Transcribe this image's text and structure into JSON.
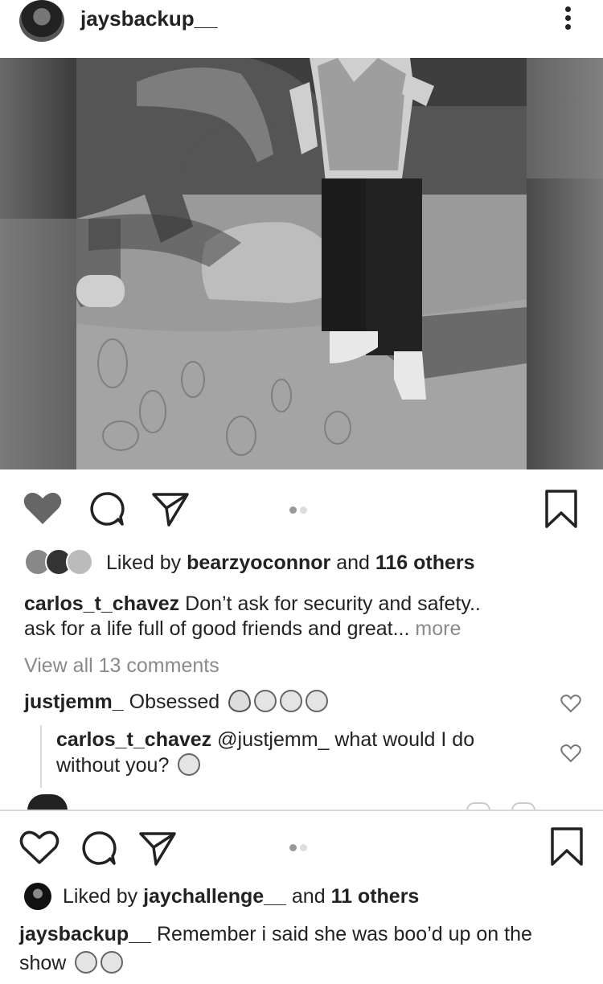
{
  "post1": {
    "username": "jaysbackup__",
    "liked_by_prefix": "Liked by ",
    "liked_by_user": "bearzyoconnor",
    "liked_by_and": " and ",
    "liked_by_others": "116 others",
    "caption_user": "carlos_t_chavez",
    "caption_line1": " Don’t ask for security and safety..",
    "caption_line2": "ask for a life full of good friends and great...",
    "caption_more": " more",
    "view_comments": "View all 13 comments",
    "comment1_user": "justjemm_",
    "comment1_text": " Obsessed ",
    "reply_user": "carlos_t_chavez",
    "reply_text_line1": " @justjemm_ what would I do",
    "reply_text_line2": "without you? ",
    "liked": true
  },
  "post2": {
    "liked_by_prefix": "Liked by ",
    "liked_by_user": "jaychallenge__",
    "liked_by_and": " and ",
    "liked_by_others": "11 others",
    "caption_user": "jaysbackup__",
    "caption_line1": " Remember i said she was boo’d up on the",
    "caption_line2": "show ",
    "liked": false
  },
  "icons": [
    "heart-icon",
    "comment-icon",
    "share-icon",
    "bookmark-icon",
    "more-options-icon",
    "carousel-dots",
    "flame-emoji",
    "heart-eyes-emoji",
    "smiling-hearts-emoji",
    "kiss-emoji",
    "wink-emoji",
    "upside-down-emoji",
    "smile-emoji"
  ],
  "colors": {
    "text": "#222222",
    "muted": "#8a8a8a",
    "liked_heart": "#666666",
    "divider": "#d8d8d8"
  }
}
